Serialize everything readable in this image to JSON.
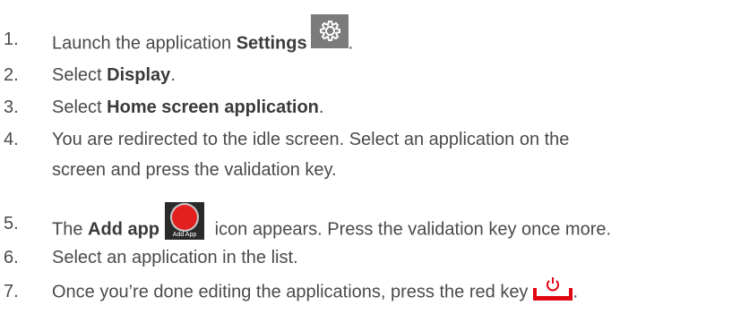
{
  "steps": [
    {
      "num": "1.",
      "text_a": "Launch the application ",
      "bold": "Settings",
      "text_b": ""
    },
    {
      "num": "2.",
      "text_a": "Select ",
      "bold": "Display",
      "text_b": "."
    },
    {
      "num": "3.",
      "text_a": "Select ",
      "bold": "Home screen application",
      "text_b": "."
    },
    {
      "num": "4.",
      "line1": "You are redirected to the idle screen. Select an application on the",
      "line2": "screen and press the validation key."
    },
    {
      "num": "5.",
      "text_a": "The ",
      "bold": "Add app",
      "text_b": " icon appears. Press the validation key once more."
    },
    {
      "num": "6.",
      "text_a": "Select an application in the list."
    },
    {
      "num": "7.",
      "text_a": "Once you’re done editing the applications, press the red key",
      "text_b": "."
    }
  ],
  "icons": {
    "settings": "gear-icon",
    "add_app": "add-app-icon",
    "add_app_label": "Add App",
    "red_key": "power-icon"
  },
  "colors": {
    "text": "#4a4a4a",
    "red": "#e30613"
  }
}
